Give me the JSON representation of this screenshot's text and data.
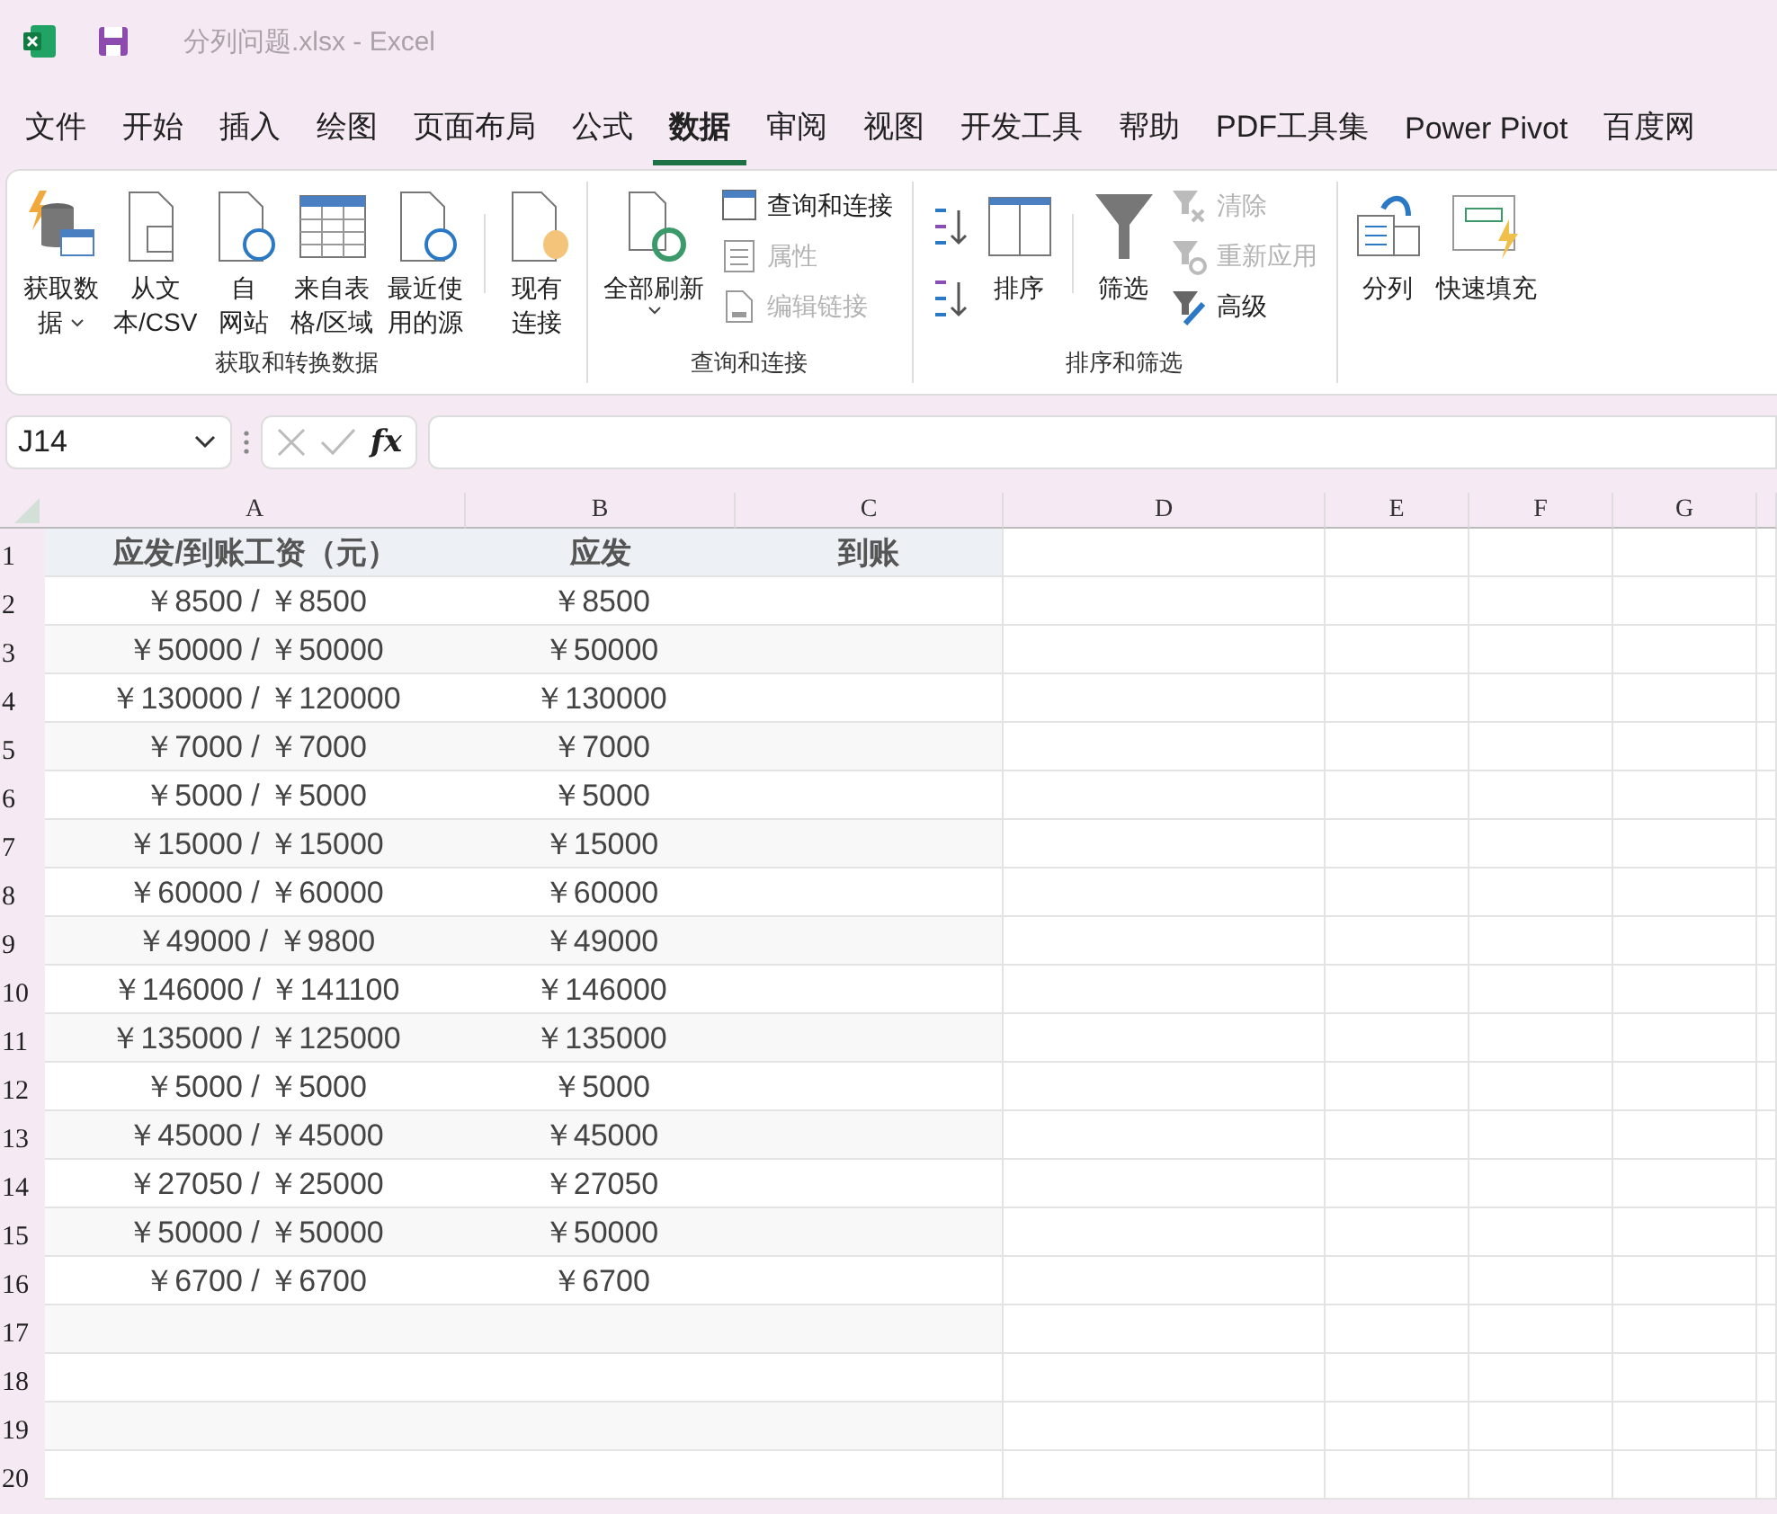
{
  "window": {
    "title": "分列问题.xlsx  -  Excel"
  },
  "tabs": [
    {
      "label": "文件",
      "selected": false
    },
    {
      "label": "开始",
      "selected": false
    },
    {
      "label": "插入",
      "selected": false
    },
    {
      "label": "绘图",
      "selected": false
    },
    {
      "label": "页面布局",
      "selected": false
    },
    {
      "label": "公式",
      "selected": false
    },
    {
      "label": "数据",
      "selected": true
    },
    {
      "label": "审阅",
      "selected": false
    },
    {
      "label": "视图",
      "selected": false
    },
    {
      "label": "开发工具",
      "selected": false
    },
    {
      "label": "帮助",
      "selected": false
    },
    {
      "label": "PDF工具集",
      "selected": false
    },
    {
      "label": "Power Pivot",
      "selected": false
    },
    {
      "label": "百度网",
      "selected": false
    }
  ],
  "ribbon": {
    "groups": [
      {
        "label": "获取和转换数据",
        "items": [
          {
            "kind": "large",
            "lines": [
              "获取数",
              "据"
            ],
            "dropdown": true
          },
          {
            "kind": "large",
            "lines": [
              "从文",
              "本/CSV"
            ]
          },
          {
            "kind": "large",
            "lines": [
              "自",
              "网站"
            ]
          },
          {
            "kind": "large",
            "lines": [
              "来自表",
              "格/区域"
            ]
          },
          {
            "kind": "large",
            "lines": [
              "最近使",
              "用的源"
            ]
          },
          {
            "kind": "separator"
          },
          {
            "kind": "large",
            "lines": [
              "现有",
              "连接"
            ]
          }
        ]
      },
      {
        "label": "查询和连接",
        "items": [
          {
            "kind": "large",
            "lines": [
              "全部刷新"
            ],
            "dropdown": true
          },
          {
            "kind": "stack",
            "entries": [
              {
                "label": "查询和连接",
                "disabled": false
              },
              {
                "label": "属性",
                "disabled": true
              },
              {
                "label": "编辑链接",
                "disabled": true
              }
            ]
          }
        ]
      },
      {
        "label": "排序和筛选",
        "items": [
          {
            "kind": "sortpair"
          },
          {
            "kind": "large",
            "lines": [
              "排序"
            ]
          },
          {
            "kind": "separator"
          },
          {
            "kind": "large",
            "lines": [
              "筛选"
            ]
          },
          {
            "kind": "stack",
            "entries": [
              {
                "label": "清除",
                "disabled": true
              },
              {
                "label": "重新应用",
                "disabled": true
              },
              {
                "label": "高级",
                "disabled": false
              }
            ]
          }
        ]
      },
      {
        "items": [
          {
            "kind": "large",
            "lines": [
              "分列"
            ]
          },
          {
            "kind": "large",
            "lines": [
              "快速填充"
            ]
          }
        ]
      }
    ]
  },
  "formula_bar": {
    "name_box": "J14",
    "function_label": "fx"
  },
  "sheet": {
    "columns": [
      "A",
      "B",
      "C",
      "D",
      "E",
      "F",
      "G"
    ],
    "rows": [
      {
        "row": "1",
        "kind": "header",
        "cells": [
          "应发/到账工资（元）",
          "应发",
          "到账"
        ]
      },
      {
        "row": "2",
        "kind": "data",
        "cells": [
          "￥8500 / ￥8500",
          "￥8500"
        ]
      },
      {
        "row": "3",
        "kind": "data",
        "cells": [
          "￥50000 / ￥50000",
          "￥50000"
        ]
      },
      {
        "row": "4",
        "kind": "data",
        "cells": [
          "￥130000 / ￥120000",
          "￥130000"
        ]
      },
      {
        "row": "5",
        "kind": "data",
        "cells": [
          "￥7000 / ￥7000",
          "￥7000"
        ]
      },
      {
        "row": "6",
        "kind": "data",
        "cells": [
          "￥5000 / ￥5000",
          "￥5000"
        ]
      },
      {
        "row": "7",
        "kind": "data",
        "cells": [
          "￥15000 / ￥15000",
          "￥15000"
        ]
      },
      {
        "row": "8",
        "kind": "data",
        "cells": [
          "￥60000 / ￥60000",
          "￥60000"
        ]
      },
      {
        "row": "9",
        "kind": "data",
        "cells": [
          "￥49000 / ￥9800",
          "￥49000"
        ]
      },
      {
        "row": "10",
        "kind": "data",
        "cells": [
          "￥146000 / ￥141100",
          "￥146000"
        ]
      },
      {
        "row": "11",
        "kind": "data",
        "cells": [
          "￥135000 / ￥125000",
          "￥135000"
        ]
      },
      {
        "row": "12",
        "kind": "data",
        "cells": [
          "￥5000 / ￥5000",
          "￥5000"
        ]
      },
      {
        "row": "13",
        "kind": "data",
        "cells": [
          "￥45000 / ￥45000",
          "￥45000"
        ]
      },
      {
        "row": "14",
        "kind": "data",
        "cells": [
          "￥27050 / ￥25000",
          "￥27050"
        ]
      },
      {
        "row": "15",
        "kind": "data",
        "cells": [
          "￥50000 / ￥50000",
          "￥50000"
        ]
      },
      {
        "row": "16",
        "kind": "data",
        "cells": [
          "￥6700 / ￥6700",
          "￥6700"
        ]
      },
      {
        "row": "17",
        "kind": "data"
      },
      {
        "row": "18",
        "kind": "data"
      },
      {
        "row": "19",
        "kind": "data"
      },
      {
        "row": "20",
        "kind": "data"
      }
    ]
  }
}
